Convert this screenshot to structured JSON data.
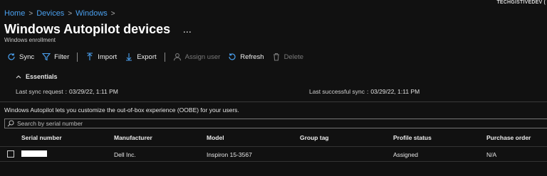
{
  "account": {
    "user_label": "TECHGISTIVEDEV ("
  },
  "breadcrumb": {
    "items": [
      "Home",
      "Devices",
      "Windows"
    ],
    "separator": ">"
  },
  "page": {
    "title": "Windows Autopilot devices",
    "more_label": "...",
    "subtitle": "Windows enrollment"
  },
  "toolbar": {
    "sync": "Sync",
    "filter": "Filter",
    "import": "Import",
    "export": "Export",
    "assign_user": "Assign user",
    "refresh": "Refresh",
    "delete": "Delete"
  },
  "essentials": {
    "label": "Essentials",
    "last_sync_request_label": "Last sync request",
    "last_sync_request_value": "03/29/22, 1:11 PM",
    "last_successful_sync_label": "Last successful sync",
    "last_successful_sync_value": "03/29/22, 1:11 PM",
    "colon": ":"
  },
  "description": "Windows Autopilot lets you customize the out-of-box experience (OOBE) for your users.",
  "search": {
    "placeholder": "Search by serial number"
  },
  "table": {
    "columns": [
      "Serial number",
      "Manufacturer",
      "Model",
      "Group tag",
      "Profile status",
      "Purchase order"
    ],
    "rows": [
      {
        "serial_number": "",
        "manufacturer": "Dell Inc.",
        "model": "Inspiron 15-3567",
        "group_tag": "",
        "profile_status": "Assigned",
        "purchase_order": "N/A"
      }
    ]
  },
  "colors": {
    "background": "#111111",
    "link": "#4aa0ef",
    "toolbar_icon": "#4aa0ef",
    "disabled": "#7a7a7a"
  }
}
